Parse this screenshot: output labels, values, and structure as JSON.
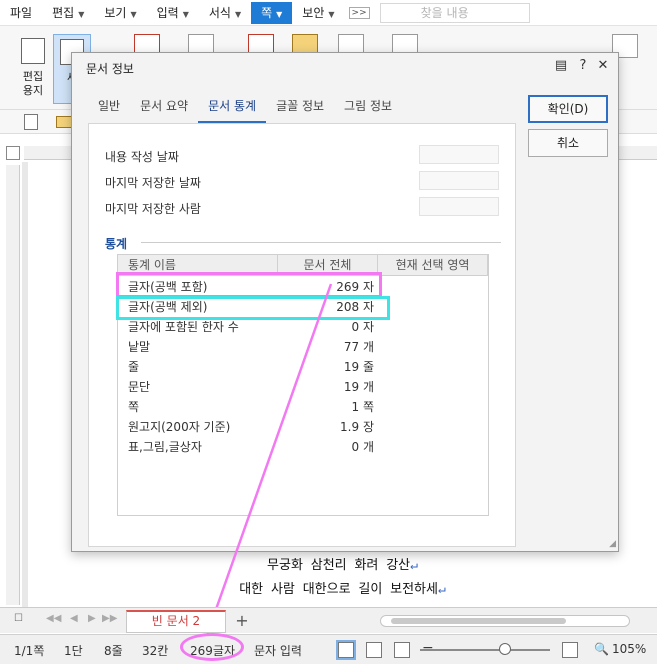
{
  "menubar": {
    "items": [
      {
        "label": "파일",
        "caret": false
      },
      {
        "label": "편집",
        "caret": true
      },
      {
        "label": "보기",
        "caret": true
      },
      {
        "label": "입력",
        "caret": true
      },
      {
        "label": "서식",
        "caret": true
      },
      {
        "label": "쪽",
        "caret": true,
        "active": true
      },
      {
        "label": "보안",
        "caret": true
      }
    ],
    "search_placeholder": "찾을 내용"
  },
  "toolbar": {
    "left_button_label": "편집\n용지",
    "selected_button_label": "세"
  },
  "dialog": {
    "title": "문서 정보",
    "tabs": [
      "일반",
      "문서 요약",
      "문서 통계",
      "글꼴 정보",
      "그림 정보"
    ],
    "active_tab": "문서 통계",
    "fields": {
      "created_date": "내용 작성 날짜",
      "last_saved_date": "마지막 저장한 날짜",
      "last_saved_by": "마지막 저장한 사람"
    },
    "section_title": "통계",
    "columns": [
      "통계 이름",
      "문서 전체",
      "현재 선택 영역"
    ],
    "rows": [
      {
        "name": "글자(공백 포함)",
        "total": "269 자"
      },
      {
        "name": "글자(공백 제외)",
        "total": "208 자"
      },
      {
        "name": "글자에 포함된 한자 수",
        "total": "0 자"
      },
      {
        "name": "낱말",
        "total": "77 개"
      },
      {
        "name": "줄",
        "total": "19 줄"
      },
      {
        "name": "문단",
        "total": "19 개"
      },
      {
        "name": "쪽",
        "total": "1 쪽"
      },
      {
        "name": "원고지(200자 기준)",
        "total": "1.9 장"
      },
      {
        "name": "표,그림,글상자",
        "total": "0 개"
      }
    ],
    "ok_label": "확인(D)",
    "cancel_label": "취소",
    "controls": {
      "help": "?",
      "close": "✕"
    }
  },
  "document": {
    "lines": [
      "무궁화 삼천리 화려 강산",
      "대한 사람 대한으로 길이 보전하세"
    ],
    "para_mark": "↵"
  },
  "doc_tabs": {
    "tab_name": "빈 문서 2",
    "add_label": "+"
  },
  "statusbar": {
    "page": "1/1쪽",
    "column": "1단",
    "line": "8줄",
    "char_pos": "32칸",
    "char_count": "269글자",
    "mode": "문자 입력",
    "zoom": "105%",
    "zoom_fraction": 0.65
  },
  "annotation_colors": {
    "pink": "#f279f2",
    "cyan": "#3fe3e3"
  }
}
